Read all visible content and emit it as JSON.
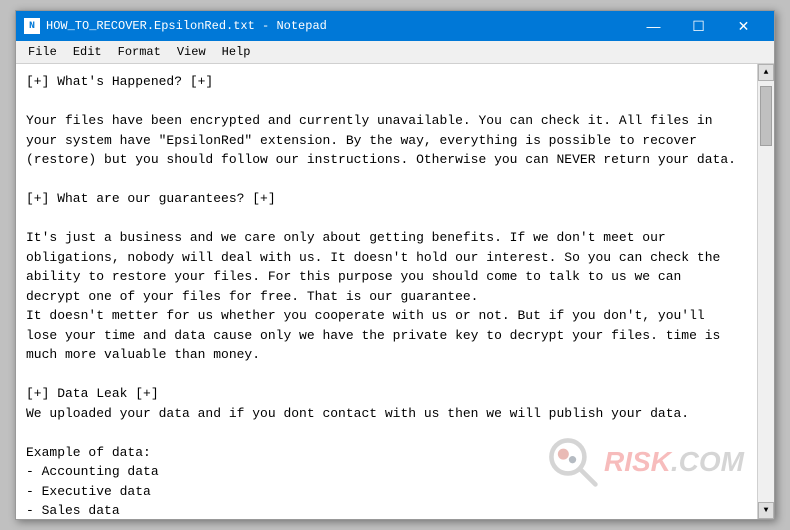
{
  "window": {
    "title": "HOW_TO_RECOVER.EpsilonRed.txt - Notepad",
    "icon": "N"
  },
  "titlebar": {
    "minimize_label": "—",
    "maximize_label": "☐",
    "close_label": "✕"
  },
  "menubar": {
    "items": [
      "File",
      "Edit",
      "Format",
      "View",
      "Help"
    ]
  },
  "content": {
    "text": "[+] What's Happened? [+]\n\nYour files have been encrypted and currently unavailable. You can check it. All files in\nyour system have \"EpsilonRed\" extension. By the way, everything is possible to recover\n(restore) but you should follow our instructions. Otherwise you can NEVER return your data.\n\n[+] What are our guarantees? [+]\n\nIt's just a business and we care only about getting benefits. If we don't meet our\nobligations, nobody will deal with us. It doesn't hold our interest. So you can check the\nability to restore your files. For this purpose you should come to talk to us we can\ndecrypt one of your files for free. That is our guarantee.\nIt doesn't metter for us whether you cooperate with us or not. But if you don't, you'll\nlose your time and data cause only we have the private key to decrypt your files. time is\nmuch more valuable than money.\n\n[+] Data Leak [+]\nWe uploaded your data and if you dont contact with us then we will publish your data.\n\nExample of data:\n- Accounting data\n- Executive data\n- Sales data\n- Customer support data\n- Marketing data\n- And more other ..."
  },
  "watermark": {
    "text": "risk.com"
  }
}
